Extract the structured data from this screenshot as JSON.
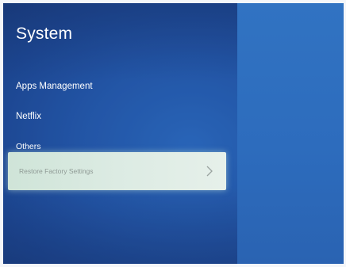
{
  "page": {
    "title": "System"
  },
  "menu": {
    "items": [
      {
        "label": "Apps Management"
      },
      {
        "label": "Netflix"
      },
      {
        "label": "Others"
      }
    ],
    "selected": {
      "label": "Restore Factory Settings",
      "icon": "chevron-right-icon"
    }
  },
  "colors": {
    "background": "#2457a8",
    "right_panel": "#2d6cbd",
    "selected_highlight": "#dcebe3",
    "text": "#ffffff",
    "selected_text": "#8f9a95"
  }
}
